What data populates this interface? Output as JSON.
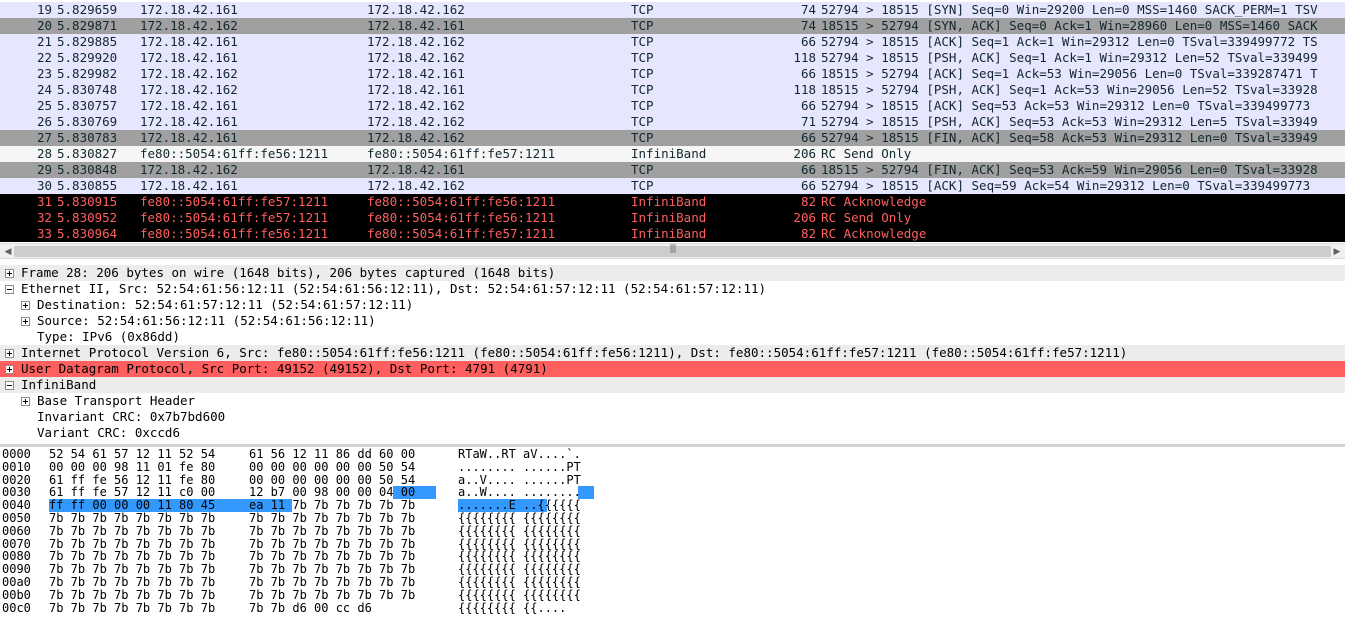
{
  "packets": [
    {
      "no": "19",
      "time": "5.829659",
      "source": "172.18.42.161",
      "destination": "172.18.42.162",
      "protocol": "TCP",
      "length": "74",
      "info": "52794 > 18515 [SYN] Seq=0 Win=29200 Len=0 MSS=1460 SACK_PERM=1 TSV",
      "style": "tcp"
    },
    {
      "no": "20",
      "time": "5.829871",
      "source": "172.18.42.162",
      "destination": "172.18.42.161",
      "protocol": "TCP",
      "length": "74",
      "info": "18515 > 52794 [SYN, ACK] Seq=0 Ack=1 Win=28960 Len=0 MSS=1460 SACK",
      "style": "flag"
    },
    {
      "no": "21",
      "time": "5.829885",
      "source": "172.18.42.161",
      "destination": "172.18.42.162",
      "protocol": "TCP",
      "length": "66",
      "info": "52794 > 18515 [ACK] Seq=1 Ack=1 Win=29312 Len=0 TSval=339499772 TS",
      "style": "tcp"
    },
    {
      "no": "22",
      "time": "5.829920",
      "source": "172.18.42.161",
      "destination": "172.18.42.162",
      "protocol": "TCP",
      "length": "118",
      "info": "52794 > 18515 [PSH, ACK] Seq=1 Ack=1 Win=29312 Len=52 TSval=339499",
      "style": "tcp"
    },
    {
      "no": "23",
      "time": "5.829982",
      "source": "172.18.42.162",
      "destination": "172.18.42.161",
      "protocol": "TCP",
      "length": "66",
      "info": "18515 > 52794 [ACK] Seq=1 Ack=53 Win=29056 Len=0 TSval=339287471 T",
      "style": "tcp"
    },
    {
      "no": "24",
      "time": "5.830748",
      "source": "172.18.42.162",
      "destination": "172.18.42.161",
      "protocol": "TCP",
      "length": "118",
      "info": "18515 > 52794 [PSH, ACK] Seq=1 Ack=53 Win=29056 Len=52 TSval=33928",
      "style": "tcp"
    },
    {
      "no": "25",
      "time": "5.830757",
      "source": "172.18.42.161",
      "destination": "172.18.42.162",
      "protocol": "TCP",
      "length": "66",
      "info": "52794 > 18515 [ACK] Seq=53 Ack=53 Win=29312 Len=0 TSval=339499773",
      "style": "tcp"
    },
    {
      "no": "26",
      "time": "5.830769",
      "source": "172.18.42.161",
      "destination": "172.18.42.162",
      "protocol": "TCP",
      "length": "71",
      "info": "52794 > 18515 [PSH, ACK] Seq=53 Ack=53 Win=29312 Len=5 TSval=33949",
      "style": "tcp"
    },
    {
      "no": "27",
      "time": "5.830783",
      "source": "172.18.42.161",
      "destination": "172.18.42.162",
      "protocol": "TCP",
      "length": "66",
      "info": "52794 > 18515 [FIN, ACK] Seq=58 Ack=53 Win=29312 Len=0 TSval=33949",
      "style": "flag"
    },
    {
      "no": "28",
      "time": "5.830827",
      "source": "fe80::5054:61ff:fe56:1211",
      "destination": "fe80::5054:61ff:fe57:1211",
      "protocol": "InfiniBand",
      "length": "206",
      "info": "RC Send Only",
      "style": "ib"
    },
    {
      "no": "29",
      "time": "5.830848",
      "source": "172.18.42.162",
      "destination": "172.18.42.161",
      "protocol": "TCP",
      "length": "66",
      "info": "18515 > 52794 [FIN, ACK] Seq=53 Ack=59 Win=29056 Len=0 TSval=33928",
      "style": "flag"
    },
    {
      "no": "30",
      "time": "5.830855",
      "source": "172.18.42.161",
      "destination": "172.18.42.162",
      "protocol": "TCP",
      "length": "66",
      "info": "52794 > 18515 [ACK] Seq=59 Ack=54 Win=29312 Len=0 TSval=339499773",
      "style": "tcp"
    },
    {
      "no": "31",
      "time": "5.830915",
      "source": "fe80::5054:61ff:fe57:1211",
      "destination": "fe80::5054:61ff:fe56:1211",
      "protocol": "InfiniBand",
      "length": "82",
      "info": "RC Acknowledge",
      "style": "err"
    },
    {
      "no": "32",
      "time": "5.830952",
      "source": "fe80::5054:61ff:fe57:1211",
      "destination": "fe80::5054:61ff:fe56:1211",
      "protocol": "InfiniBand",
      "length": "206",
      "info": "RC Send Only",
      "style": "err"
    },
    {
      "no": "33",
      "time": "5.830964",
      "source": "fe80::5054:61ff:fe56:1211",
      "destination": "fe80::5054:61ff:fe57:1211",
      "protocol": "InfiniBand",
      "length": "82",
      "info": "RC Acknowledge",
      "style": "err"
    }
  ],
  "scrollbar": {
    "left_icon": "scroll-left-arrow-icon",
    "right_icon": "scroll-right-arrow-icon",
    "grip": "|||"
  },
  "details": [
    {
      "text": "Frame 28: 206 bytes on wire (1648 bits), 206 bytes captured (1648 bits)",
      "indent": 0,
      "expander": "plus",
      "highlight": "grey"
    },
    {
      "text": "Ethernet II, Src: 52:54:61:56:12:11 (52:54:61:56:12:11), Dst: 52:54:61:57:12:11 (52:54:61:57:12:11)",
      "indent": 0,
      "expander": "minus",
      "highlight": "none"
    },
    {
      "text": "Destination: 52:54:61:57:12:11 (52:54:61:57:12:11)",
      "indent": 1,
      "expander": "plus",
      "highlight": "none"
    },
    {
      "text": "Source: 52:54:61:56:12:11 (52:54:61:56:12:11)",
      "indent": 1,
      "expander": "plus",
      "highlight": "none"
    },
    {
      "text": "Type: IPv6 (0x86dd)",
      "indent": 1,
      "expander": "none",
      "highlight": "none"
    },
    {
      "text": "Internet Protocol Version 6, Src: fe80::5054:61ff:fe56:1211 (fe80::5054:61ff:fe56:1211), Dst: fe80::5054:61ff:fe57:1211 (fe80::5054:61ff:fe57:1211)",
      "indent": 0,
      "expander": "plus",
      "highlight": "grey"
    },
    {
      "text": "User Datagram Protocol, Src Port: 49152 (49152), Dst Port: 4791 (4791)",
      "indent": 0,
      "expander": "plus",
      "highlight": "red"
    },
    {
      "text": "InfiniBand",
      "indent": 0,
      "expander": "minus",
      "highlight": "grey"
    },
    {
      "text": "Base Transport Header",
      "indent": 1,
      "expander": "plus",
      "highlight": "none"
    },
    {
      "text": "Invariant CRC: 0x7b7bd600",
      "indent": 1,
      "expander": "none",
      "highlight": "none"
    },
    {
      "text": "Variant CRC: 0xccd6",
      "indent": 1,
      "expander": "none",
      "highlight": "none"
    }
  ],
  "hex_dump": [
    {
      "offset": "0000",
      "a": "52 54 61 57 12 11 52 54",
      "b": "61 56 12 11 86 dd 60 00",
      "ascii": "RTaW..RT aV....`."
    },
    {
      "offset": "0010",
      "a": "00 00 00 98 11 01 fe 80",
      "b": "00 00 00 00 00 00 50 54",
      "ascii": "........ ......PT"
    },
    {
      "offset": "0020",
      "a": "61 ff fe 56 12 11 fe 80",
      "b": "00 00 00 00 00 00 50 54",
      "ascii": "a..V.... ......PT"
    },
    {
      "offset": "0030",
      "a": "61 ff fe 57 12 11 c0 00",
      "b": "12 b7 00 98 00 00 04 00",
      "ascii": "a..W.... ........"
    },
    {
      "offset": "0040",
      "a": "ff ff 00 00 00 11 80 45",
      "b": "ea 11 7b 7b 7b 7b 7b 7b",
      "ascii": ".......E ..{{{{{{"
    },
    {
      "offset": "0050",
      "a": "7b 7b 7b 7b 7b 7b 7b 7b",
      "b": "7b 7b 7b 7b 7b 7b 7b 7b",
      "ascii": "{{{{{{{{ {{{{{{{{"
    },
    {
      "offset": "0060",
      "a": "7b 7b 7b 7b 7b 7b 7b 7b",
      "b": "7b 7b 7b 7b 7b 7b 7b 7b",
      "ascii": "{{{{{{{{ {{{{{{{{"
    },
    {
      "offset": "0070",
      "a": "7b 7b 7b 7b 7b 7b 7b 7b",
      "b": "7b 7b 7b 7b 7b 7b 7b 7b",
      "ascii": "{{{{{{{{ {{{{{{{{"
    },
    {
      "offset": "0080",
      "a": "7b 7b 7b 7b 7b 7b 7b 7b",
      "b": "7b 7b 7b 7b 7b 7b 7b 7b",
      "ascii": "{{{{{{{{ {{{{{{{{"
    },
    {
      "offset": "0090",
      "a": "7b 7b 7b 7b 7b 7b 7b 7b",
      "b": "7b 7b 7b 7b 7b 7b 7b 7b",
      "ascii": "{{{{{{{{ {{{{{{{{"
    },
    {
      "offset": "00a0",
      "a": "7b 7b 7b 7b 7b 7b 7b 7b",
      "b": "7b 7b 7b 7b 7b 7b 7b 7b",
      "ascii": "{{{{{{{{ {{{{{{{{"
    },
    {
      "offset": "00b0",
      "a": "7b 7b 7b 7b 7b 7b 7b 7b",
      "b": "7b 7b 7b 7b 7b 7b 7b 7b",
      "ascii": "{{{{{{{{ {{{{{{{{"
    },
    {
      "offset": "00c0",
      "a": "7b 7b 7b 7b 7b 7b 7b 7b",
      "b": "7b 7b d6 00 cc d6",
      "ascii": "{{{{{{{{ {{...."
    }
  ],
  "colors": {
    "selection": "#3399ff",
    "error_text": "#ff5f5f",
    "error_bg": "#000000",
    "tcp_bg": "#e7e6ff",
    "flag_bg": "#a0a0a0",
    "udp_highlight": "#ff5f5f"
  }
}
